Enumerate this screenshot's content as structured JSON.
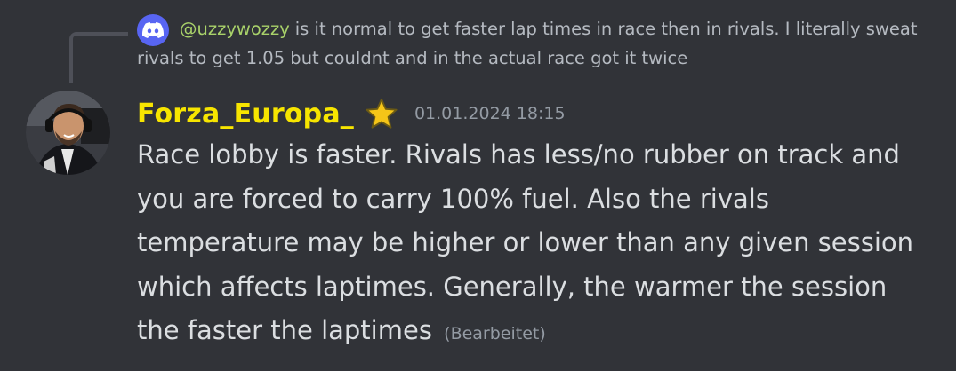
{
  "reply": {
    "icon": "discord-logo-icon",
    "mention": "@uzzywozzy",
    "text": "is it normal to get faster lap times in race then in rivals. I literally sweat rivals to get 1.05 but couldnt and in the actual race got it twice"
  },
  "message": {
    "username": "Forza_Europa_",
    "username_color": "#f7e500",
    "badge_icon": "star-icon",
    "timestamp": "01.01.2024 18:15",
    "content": "Race lobby is faster. Rivals has less/no rubber on track and you are forced to carry 100% fuel. Also the rivals temperature may be higher or lower than any given session which affects laptimes. Generally, the warmer the session the faster the laptimes",
    "edited_label": "(Bearbeitet)"
  },
  "colors": {
    "background": "#313338",
    "mention": "#a9d26a",
    "muted": "#949ba4",
    "text": "#dbdee1"
  }
}
